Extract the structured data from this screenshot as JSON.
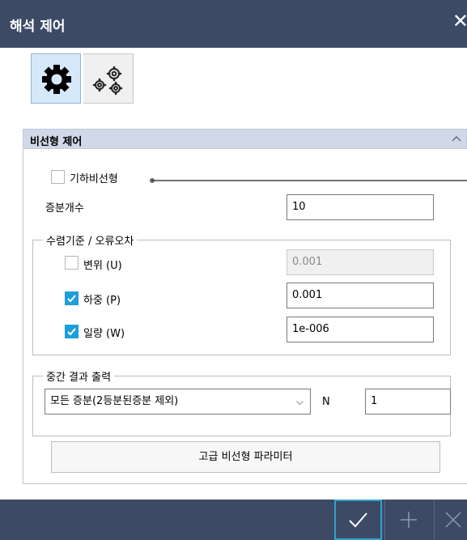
{
  "window": {
    "title": "해석 제어",
    "close_glyph": "✕"
  },
  "toolbar": {
    "buttons": [
      {
        "icon": "single-gear-icon",
        "active": true
      },
      {
        "icon": "multi-gear-icon",
        "active": false
      }
    ]
  },
  "section": {
    "title": "비선형 제어",
    "collapse_icon": "chevron-up-icon"
  },
  "geometric_nonlinear": {
    "label": "기하비선형",
    "checked": false
  },
  "increments": {
    "label": "증분개수",
    "value": "10"
  },
  "convergence": {
    "title": "수렴기준 / 오류오차",
    "rows": [
      {
        "label": "변위 (U)",
        "checked": false,
        "value": "0.001",
        "enabled": false
      },
      {
        "label": "하중 (P)",
        "checked": true,
        "value": "0.001",
        "enabled": true
      },
      {
        "label": "일량 (W)",
        "checked": true,
        "value": "1e-006",
        "enabled": true
      }
    ]
  },
  "intermediate_output": {
    "title": "중간 결과 출력",
    "select_value": "모든 증분(2등분된증분 제외)",
    "n_label": "N",
    "n_value": "1"
  },
  "advanced_button": "고급 비선형 파라미터",
  "footer": {
    "buttons": [
      "confirm-icon",
      "add-icon",
      "close-icon"
    ]
  },
  "colors": {
    "title_bar": "#3c4a66",
    "section_header": "#cfd9e7",
    "checkbox_checked": "#1e9fd8",
    "active_tool": "#d6e9fa",
    "confirm_border": "#2ea4c8"
  }
}
